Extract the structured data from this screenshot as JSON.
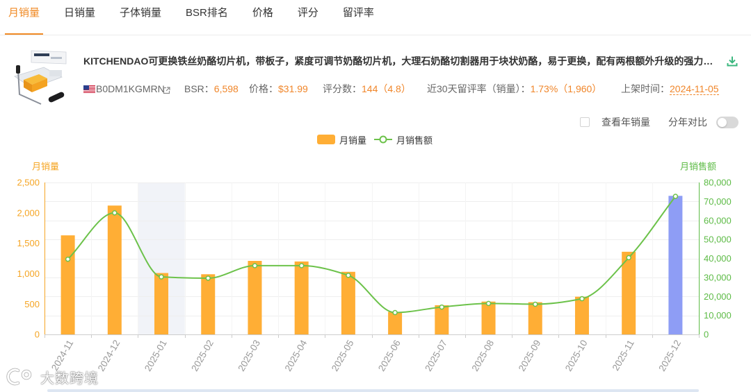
{
  "tabs": [
    {
      "label": "月销量",
      "active": true
    },
    {
      "label": "日销量",
      "active": false
    },
    {
      "label": "子体销量",
      "active": false
    },
    {
      "label": "BSR排名",
      "active": false
    },
    {
      "label": "价格",
      "active": false
    },
    {
      "label": "评分",
      "active": false
    },
    {
      "label": "留评率",
      "active": false
    }
  ],
  "product": {
    "title": "KITCHENDAO可更换铁丝奶酪切片机，带板子，紧度可调节奶酪切片机，大理石奶酪切割器用于块状奶酪，易于更换，配有两根额外升级的强力钢丝",
    "asin": "B0DM1KGMRN",
    "bsr_label": "BSR：",
    "bsr_value": "6,598",
    "price_label": "价格：",
    "price_value": "$31.99",
    "ratings_label": "评分数：",
    "ratings_value": "144（4.8）",
    "review_rate_label": "近30天留评率（销量）：",
    "review_rate_value": "1.73%（1,960）",
    "listed_label": "上架时间：",
    "listed_value": "2024-11-05"
  },
  "icons": {
    "product_image": "cheese-slicer-product-image",
    "flag": "us-flag-icon",
    "external_link": "external-link-icon",
    "download": "download-icon",
    "watermark_logo": "watermark-logo-icon"
  },
  "controls": {
    "yearly_checkbox_label": "查看年销量",
    "yearly_checked": false,
    "compare_label": "分年对比",
    "compare_on": false
  },
  "colors": {
    "accent": "#F08A24",
    "value": "#F0862A",
    "bar": "#FFAE35",
    "bar_current": "#8E9DF5",
    "line": "#6CC24A",
    "left_axis": "#F5A524",
    "right_axis": "#5DBB46",
    "download_icon": "#3BB77E",
    "hover_shade": "#F1F3F8",
    "axis_label": "#999999"
  },
  "watermark": {
    "text": "大数跨境"
  },
  "chart_data": {
    "type": "bar",
    "categories": [
      "2024-11",
      "2024-12",
      "2025-01",
      "2025-02",
      "2025-03",
      "2025-04",
      "2025-05",
      "2025-06",
      "2025-07",
      "2025-08",
      "2025-09",
      "2025-10",
      "2025-11",
      "2025-12"
    ],
    "series": [
      {
        "name": "月销量",
        "type": "bar",
        "y_axis_index": 0,
        "values": [
          1630,
          2120,
          1010,
          990,
          1210,
          1200,
          1030,
          370,
          480,
          540,
          530,
          620,
          1360,
          2280
        ]
      },
      {
        "name": "月销售额",
        "type": "line",
        "y_axis_index": 1,
        "smooth": true,
        "values": [
          39600,
          64000,
          30300,
          29600,
          36200,
          36200,
          31100,
          11500,
          14400,
          16300,
          15900,
          18800,
          40400,
          72700
        ]
      }
    ],
    "y_left": {
      "label": "月销量",
      "range": [
        0,
        2500
      ],
      "tick_labels": [
        "0",
        "500",
        "1,000",
        "1,500",
        "2,000",
        "2,500"
      ]
    },
    "y_right": {
      "label": "月销售额",
      "range": [
        0,
        80000
      ],
      "tick_labels": [
        "0",
        "10,000",
        "20,000",
        "30,000",
        "40,000",
        "50,000",
        "60,000",
        "70,000",
        "80,000"
      ]
    },
    "legend": "top-center",
    "grid": true,
    "hover_index": 2,
    "bar_highlight_index": 13
  }
}
